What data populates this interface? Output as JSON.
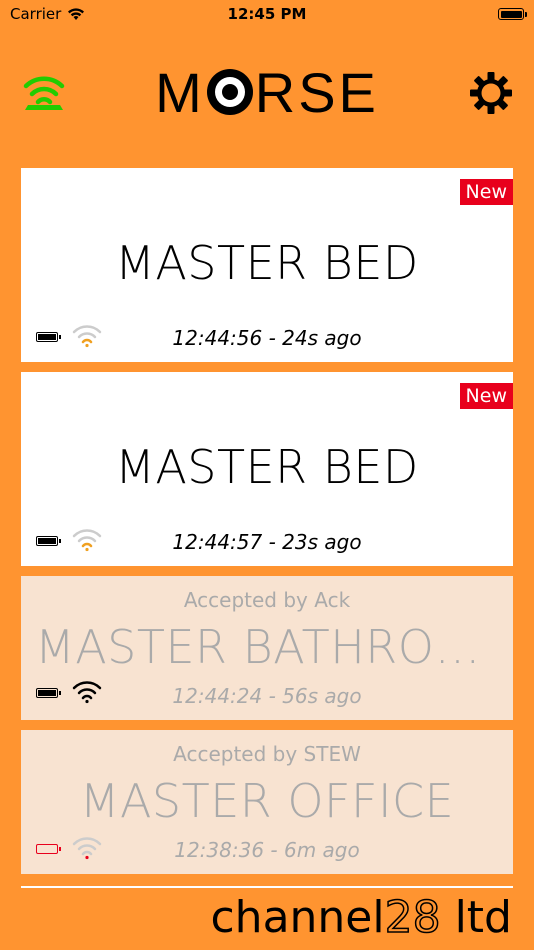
{
  "status_bar": {
    "carrier": "Carrier",
    "time": "12:45 PM"
  },
  "header": {
    "logo_left": "M",
    "logo_right": "RSE",
    "wifi_icon_color": "#22CC00"
  },
  "cards": [
    {
      "title": "MASTER BED",
      "badge": "New",
      "time": "12:44:56 - 24s ago",
      "battery": "full",
      "wifi_color": "#F0A020"
    },
    {
      "title": "MASTER BED",
      "badge": "New",
      "time": "12:44:57 - 23s ago",
      "battery": "full",
      "wifi_color": "#F0A020"
    },
    {
      "subtitle": "Accepted by Ack",
      "title": "MASTER BATHROO…",
      "time": "12:44:24 - 56s ago",
      "battery": "full",
      "wifi_color": "#000000"
    },
    {
      "subtitle": "Accepted by STEW",
      "title": "MASTER OFFICE",
      "time": "12:38:36 - 6m ago",
      "battery": "low",
      "wifi_color": "#E8001C"
    }
  ],
  "footer": {
    "brand_prefix": "channel",
    "brand_number": "28",
    "brand_suffix": " ltd"
  },
  "colors": {
    "background": "#FF9430",
    "badge": "#E8001C",
    "accepted_card": "#F8E3D1"
  }
}
